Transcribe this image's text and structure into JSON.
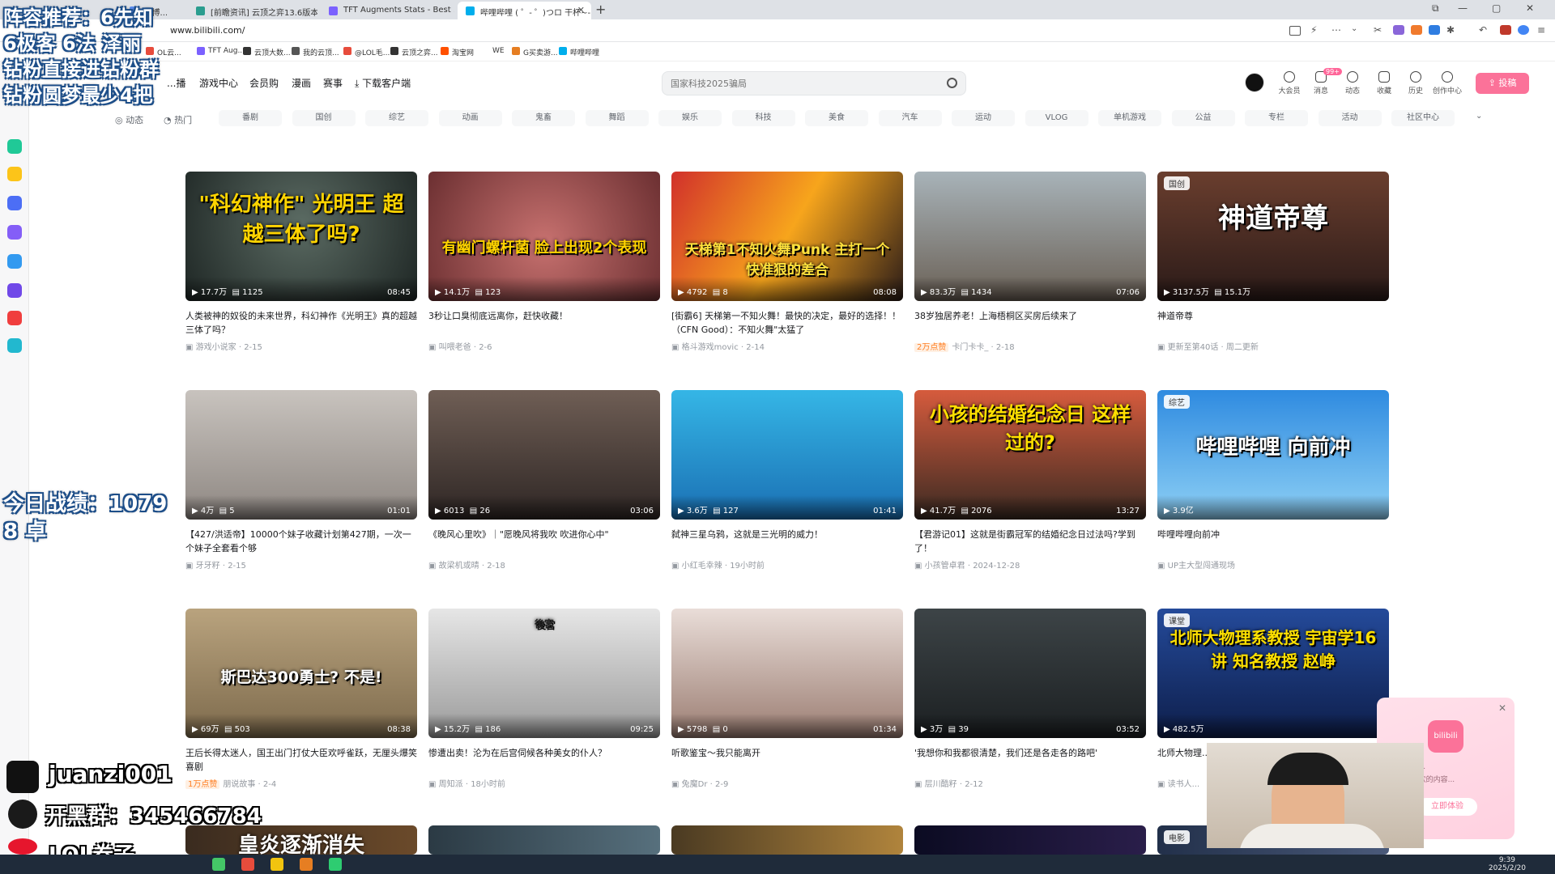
{
  "browser": {
    "tabs": [
      {
        "label": "...博..."
      },
      {
        "label": "[前瞻资讯] 云顶之弈13.6版本..."
      },
      {
        "label": "TFT Augments Stats - Best ..."
      },
      {
        "label": "哔哩哔哩 ( ゜- ゜)つロ 干杯~-..."
      }
    ],
    "url": "www.bilibili.com/",
    "bookmarks": [
      "OL云...",
      "TFT Aug...",
      "云顶大数...",
      "我的云顶...",
      "@LOL毛...",
      "云顶之弈...",
      "淘宝网",
      "WE",
      "G买卖游...",
      "哔哩哔哩"
    ]
  },
  "nav": {
    "left": [
      "...播",
      "游戏中心",
      "会员购",
      "漫画",
      "赛事",
      "下载客户端"
    ],
    "search_placeholder": "国家科技2025骗局",
    "right": [
      {
        "label": "大会员",
        "icon": "vip-icon"
      },
      {
        "label": "消息",
        "icon": "message-icon",
        "badge": "99+"
      },
      {
        "label": "动态",
        "icon": "dynamic-icon"
      },
      {
        "label": "收藏",
        "icon": "star-icon"
      },
      {
        "label": "历史",
        "icon": "history-icon"
      },
      {
        "label": "创作中心",
        "icon": "bulb-icon"
      }
    ],
    "upload_label": "投稿"
  },
  "channels": {
    "fixed": [
      "动态",
      "热门"
    ],
    "items": [
      "番剧",
      "国创",
      "综艺",
      "动画",
      "鬼畜",
      "舞蹈",
      "娱乐",
      "科技",
      "美食",
      "汽车",
      "运动",
      "VLOG",
      "单机游戏",
      "公益",
      "专栏",
      "活动",
      "社区中心"
    ]
  },
  "videos": [
    {
      "title": "人类被神的奴役的未来世界，科幻神作《光明王》真的超越三体了吗？",
      "views": "17.7万",
      "danmaku": "1125",
      "duration": "08:45",
      "author": "游戏小说家",
      "date": "2-15",
      "overlay": "\"科幻神作\" 光明王 超越三体了吗?"
    },
    {
      "title": "3秒让口臭彻底远离你，赶快收藏！",
      "views": "14.1万",
      "danmaku": "123",
      "duration": "",
      "author": "叫喂老爸",
      "date": "2-6",
      "overlay": "有幽门螺杆菌 脸上出现2个表现"
    },
    {
      "title": "[街霸6] 天梯第一不知火舞！最快的决定，最好的选择！！（CFN Good）：不知火舞\"太猛了",
      "views": "4792",
      "danmaku": "8",
      "duration": "08:08",
      "author": "格斗游戏movic",
      "date": "2-14",
      "overlay": "天梯第1不知火舞Punk 主打一个快准狠的差合"
    },
    {
      "title": "38岁独居养老！上海梧桐区买房后续来了",
      "views": "83.3万",
      "danmaku": "1434",
      "duration": "07:06",
      "author": "卡门卡卡_",
      "date": "2-18",
      "hot": "2万点赞",
      "overlay": ""
    },
    {
      "title": "神道帝尊",
      "views": "3137.5万",
      "danmaku": "15.1万",
      "duration": "",
      "author": "更新至第40话",
      "date": "周二更新",
      "tag": "国创",
      "overlay": "神道帝尊"
    },
    {
      "title": "【427/洪适帝】10000个妹子收藏计划第427期，一次一个妹子全套看个够",
      "views": "4万",
      "danmaku": "5",
      "duration": "01:01",
      "author": "牙牙籽",
      "date": "2-15",
      "overlay": ""
    },
    {
      "title": "《晚风心里吹》｜\"愿晚风将我吹 吹进你心中\"",
      "views": "6013",
      "danmaku": "26",
      "duration": "03:06",
      "author": "故梁机或晴",
      "date": "2-18",
      "overlay": ""
    },
    {
      "title": "弑神三星乌鸦，这就是三光明的威力！",
      "views": "3.6万",
      "danmaku": "127",
      "duration": "01:41",
      "author": "小红毛幸辣",
      "date": "19小时前",
      "overlay": ""
    },
    {
      "title": "【君游记01】这就是街霸冠军的结婚纪念日过法吗?学到了！",
      "views": "41.7万",
      "danmaku": "2076",
      "duration": "13:27",
      "author": "小孩管卓君",
      "date": "2024-12-28",
      "overlay": "小孩的结婚纪念日 这样过的?"
    },
    {
      "title": "哔哩哔哩向前冲",
      "views": "3.9亿",
      "danmaku": "",
      "duration": "",
      "author": "UP主大型闯通现场",
      "date": "",
      "tag": "综艺",
      "overlay": "哔哩哔哩 向前冲"
    },
    {
      "title": "王后长得太迷人，国王出门打仗大臣欢呼雀跃，无厘头爆笑喜剧",
      "views": "69万",
      "danmaku": "503",
      "duration": "08:38",
      "author": "朋说故事",
      "date": "2-4",
      "hot": "1万点赞",
      "overlay": "斯巴达300勇士? 不是!"
    },
    {
      "title": "惨遭出卖！沦为在后宫伺候各种美女的仆人？",
      "views": "15.2万",
      "danmaku": "186",
      "duration": "09:25",
      "author": "周知派",
      "date": "18小时前",
      "overlay": "後宮"
    },
    {
      "title": "听歌鉴宝～我只能离开",
      "views": "5798",
      "danmaku": "0",
      "duration": "01:34",
      "author": "兔魔Dr",
      "date": "2-9",
      "overlay": ""
    },
    {
      "title": "'我想你和我都很清楚，我们还是各走各的路吧'",
      "views": "3万",
      "danmaku": "39",
      "duration": "03:52",
      "author": "层川酷籽",
      "date": "2-12",
      "overlay": ""
    },
    {
      "title": "北师大物理...",
      "views": "482.5万",
      "danmaku": "",
      "duration": "",
      "author": "读书人...",
      "date": "",
      "tag": "课堂",
      "overlay": "北师大物理系教授 宇宙学16讲 知名教授 赵峥"
    }
  ],
  "bottom_row": {
    "overlay": "皇炎逐渐消失",
    "tag": "电影"
  },
  "stream_overlay": {
    "lines": [
      "阵容推荐：6先知",
      "6极客 6法 泽丽",
      "钻粉直接进钻粉群",
      "钻粉圆梦最少4把"
    ],
    "record": [
      "今日战绩：1079",
      "8 卓"
    ],
    "douyin": "juanzi001",
    "qq": "开黑群：345466784",
    "weibo": "LOL卷子"
  },
  "popup": {
    "text": "...键即可...\n...把你喜欢的内容...",
    "button": "立即体验",
    "logo": "bilibili"
  },
  "taskbar": {
    "time": "9:39",
    "date": "2025/2/20"
  },
  "colors": {
    "brand": "#fb7299",
    "accent": "#00aeec"
  }
}
